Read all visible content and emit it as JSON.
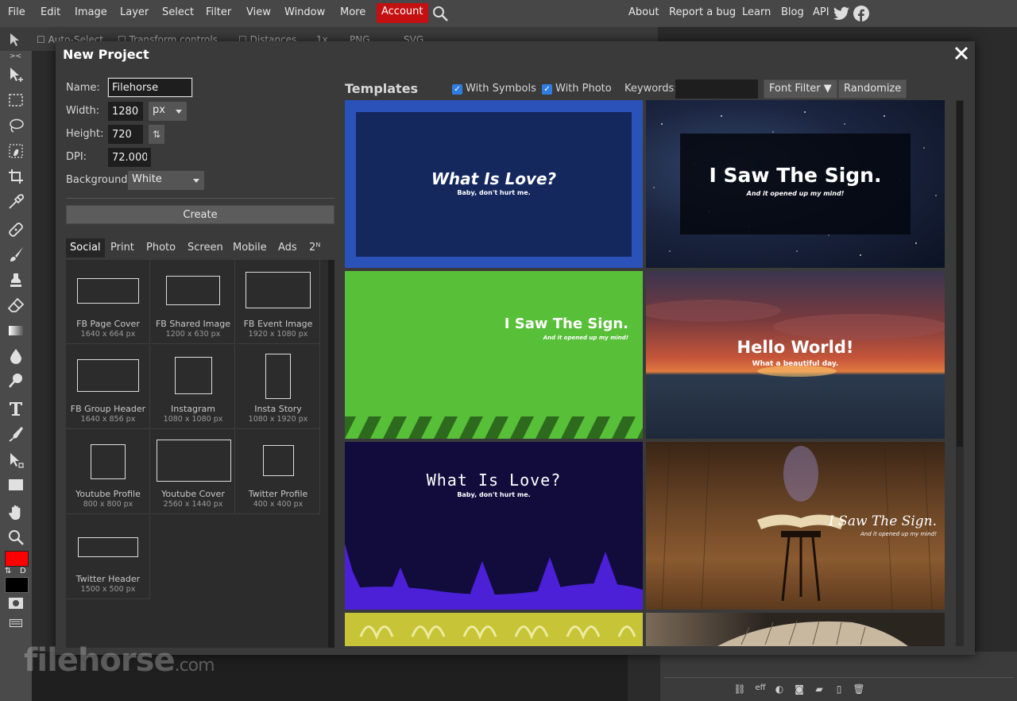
{
  "menubar": {
    "left_items": [
      "File",
      "Edit",
      "Image",
      "Layer",
      "Select",
      "Filter",
      "View",
      "Window",
      "More"
    ],
    "account": "Account",
    "right_items": [
      "About",
      "Report a bug",
      "Learn",
      "Blog",
      "API"
    ]
  },
  "optionsbar": {
    "auto_select": "Auto-Select",
    "transform_controls": "Transform controls",
    "distances": "Distances",
    "zoom": "1x",
    "png": "PNG",
    "svg": "SVG"
  },
  "tools": [
    "move",
    "marquee",
    "lasso",
    "quick-select",
    "crop",
    "eyedropper",
    "healing",
    "brush",
    "clone-stamp",
    "eraser",
    "gradient",
    "blur",
    "dodge",
    "type",
    "pen",
    "path-select",
    "shape",
    "hand",
    "zoom"
  ],
  "colors": {
    "foreground": "#ff0000",
    "background": "#000000",
    "accent": "#c41010",
    "checkbox": "#2f7de1"
  },
  "dialog": {
    "title": "New Project",
    "form": {
      "name_label": "Name:",
      "name_value": "Filehorse",
      "width_label": "Width:",
      "width_value": "1280",
      "unit": "px",
      "height_label": "Height:",
      "height_value": "720",
      "dpi_label": "DPI:",
      "dpi_value": "72.000",
      "background_label": "Background:",
      "background_value": "White"
    },
    "create_label": "Create",
    "categories": [
      "Social",
      "Print",
      "Photo",
      "Screen",
      "Mobile",
      "Ads",
      "2ᴺ"
    ],
    "active_category": "Social",
    "presets": [
      {
        "name": "FB Page Cover",
        "size": "1640 x 664 px"
      },
      {
        "name": "FB Shared Image",
        "size": "1200 x 630 px"
      },
      {
        "name": "FB Event Image",
        "size": "1920 x 1080 px"
      },
      {
        "name": "FB Group Header",
        "size": "1640 x 856 px"
      },
      {
        "name": "Instagram",
        "size": "1080 x 1080 px"
      },
      {
        "name": "Insta Story",
        "size": "1080 x 1920 px"
      },
      {
        "name": "Youtube Profile",
        "size": "800 x 800 px"
      },
      {
        "name": "Youtube Cover",
        "size": "2560 x 1440 px"
      },
      {
        "name": "Twitter Profile",
        "size": "400 x 400 px"
      },
      {
        "name": "Twitter Header",
        "size": "1500 x 500 px"
      }
    ],
    "templates": {
      "title": "Templates",
      "with_symbols": "With Symbols",
      "with_photo": "With Photo",
      "keywords_label": "Keywords:",
      "keywords_value": "",
      "font_filter": "Font Filter ▼",
      "randomize": "Randomize",
      "cards": [
        {
          "title": "What Is Love?",
          "subtitle": "Baby, don't hurt me."
        },
        {
          "title": "I Saw The Sign.",
          "subtitle": "And it opened up my mind!"
        },
        {
          "title": "I Saw The Sign.",
          "subtitle": "And it opened up my mind!"
        },
        {
          "title": "Hello World!",
          "subtitle": "What a beautiful day."
        },
        {
          "title": "What Is Love?",
          "subtitle": "Baby, don't hurt me."
        },
        {
          "title": "I Saw The Sign.",
          "subtitle": "And it opened up my mind!"
        }
      ]
    }
  },
  "watermark": {
    "brand": "filehorse",
    "domain": ".com"
  }
}
